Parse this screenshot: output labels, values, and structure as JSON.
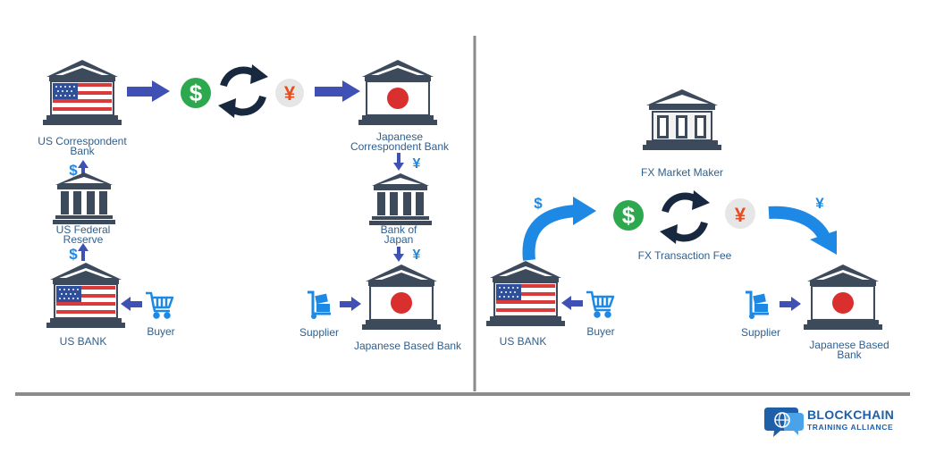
{
  "left": {
    "us_correspondent_bank": "US Correspondent\nBank",
    "japanese_correspondent_bank": "Japanese\nCorrespondent Bank",
    "us_federal_reserve": "US Federal\nReserve",
    "bank_of_japan": "Bank of\nJapan",
    "us_bank": "US BANK",
    "buyer": "Buyer",
    "supplier": "Supplier",
    "japanese_based_bank": "Japanese Based Bank"
  },
  "right": {
    "fx_market_maker": "FX Market Maker",
    "fx_transaction_fee": "FX Transaction Fee",
    "us_bank": "US BANK",
    "buyer": "Buyer",
    "supplier": "Supplier",
    "japanese_based_bank": "Japanese Based Bank"
  },
  "symbols": {
    "dollar": "$",
    "yen": "¥"
  },
  "brand": {
    "line1": "BLOCKCHAIN",
    "line2": "TRAINING ALLIANCE"
  },
  "colors": {
    "arrow_blue": "#3f51b5",
    "light_blue": "#1e88e5",
    "dollar_green": "#2ea84f",
    "yen_orange": "#e84b1c",
    "yen_bg": "#e6e6e6",
    "bank_dark": "#3d4a5c",
    "bank_light": "#f2f2f2",
    "flag_red": "#d93a3a",
    "flag_blue": "#2f4f9a",
    "cycle_navy": "#17283f",
    "divider_gray": "#8a8a8a",
    "label_text": "#2f5f8f",
    "brand_blue": "#1f5fa8"
  }
}
